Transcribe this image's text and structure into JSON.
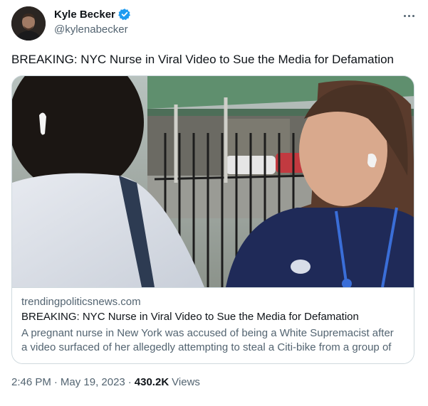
{
  "author": {
    "display_name": "Kyle Becker",
    "handle": "@kylenabecker",
    "verified_color": "#1d9bf0"
  },
  "tweet": {
    "text": "BREAKING: NYC Nurse in Viral Video to Sue the Media for Defamation"
  },
  "card": {
    "domain": "trendingpoliticsnews.com",
    "title": "BREAKING: NYC Nurse in Viral Video to Sue the Media for Defamation",
    "description_line1": "A pregnant nurse in New York was accused of being a White Supremacist after",
    "description_line2": "a video surfaced of her allegedly attempting to steal a Citi-bike from a group of"
  },
  "meta": {
    "time": "2:46 PM",
    "separator1": "·",
    "date": "May 19, 2023",
    "separator2": "·",
    "views_count": "430.2K",
    "views_label": "Views"
  },
  "icons": {
    "more": "more-horizontal-icon",
    "verified": "verified-badge-icon"
  }
}
